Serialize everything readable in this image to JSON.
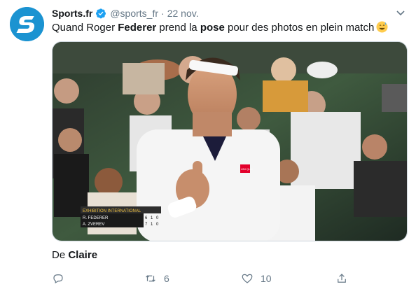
{
  "tweet": {
    "display_name": "Sports.fr",
    "handle": "@sports_fr",
    "separator": "·",
    "date": "22 nov.",
    "text_parts": {
      "p1": "Quand Roger ",
      "bold1": "Federer",
      "p2": " prend la ",
      "bold2": "pose",
      "p3": " pour des photos en plein match"
    },
    "emoji": "sweat-smile-emoji",
    "credit_prefix": "De ",
    "credit_name": "Claire"
  },
  "scoreboard": {
    "title": "EXHIBITION INTERNATIONAL",
    "player1": "R. FEDERER",
    "player2": "A. ZVEREV",
    "p1_scores": [
      "6",
      "1",
      "0"
    ],
    "p2_scores": [
      "7",
      "1",
      "0"
    ]
  },
  "shirt_logo": "UNI QLO",
  "actions": {
    "reply_icon": "reply-icon",
    "retweet_count": "6",
    "like_count": "10",
    "share_icon": "share-icon"
  },
  "colors": {
    "brand_avatar": "#1b93d1",
    "verified": "#1da1f2",
    "secondary_text": "#657786"
  }
}
